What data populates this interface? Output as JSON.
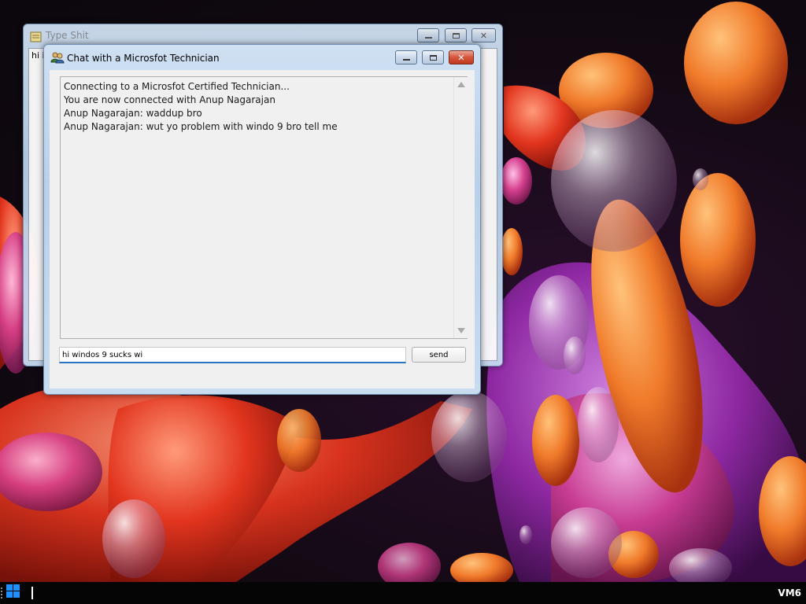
{
  "background_window": {
    "title": "Type Shit",
    "document_text": "hi it"
  },
  "chat_window": {
    "title": "Chat with a Microsfot Technician",
    "transcript": [
      "Connecting to a Microsfot Certified Technician...",
      "You are now connected with Anup Nagarajan",
      "Anup Nagarajan: waddup bro",
      "Anup Nagarajan: wut yo problem with windo 9 bro tell me"
    ],
    "input_value": "hi windos 9 sucks wi",
    "send_label": "send"
  },
  "taskbar": {
    "machine_label": "VM6"
  },
  "colors": {
    "accent": "#2a73c2",
    "close_button": "#c0391f",
    "taskbar": "#050505"
  }
}
